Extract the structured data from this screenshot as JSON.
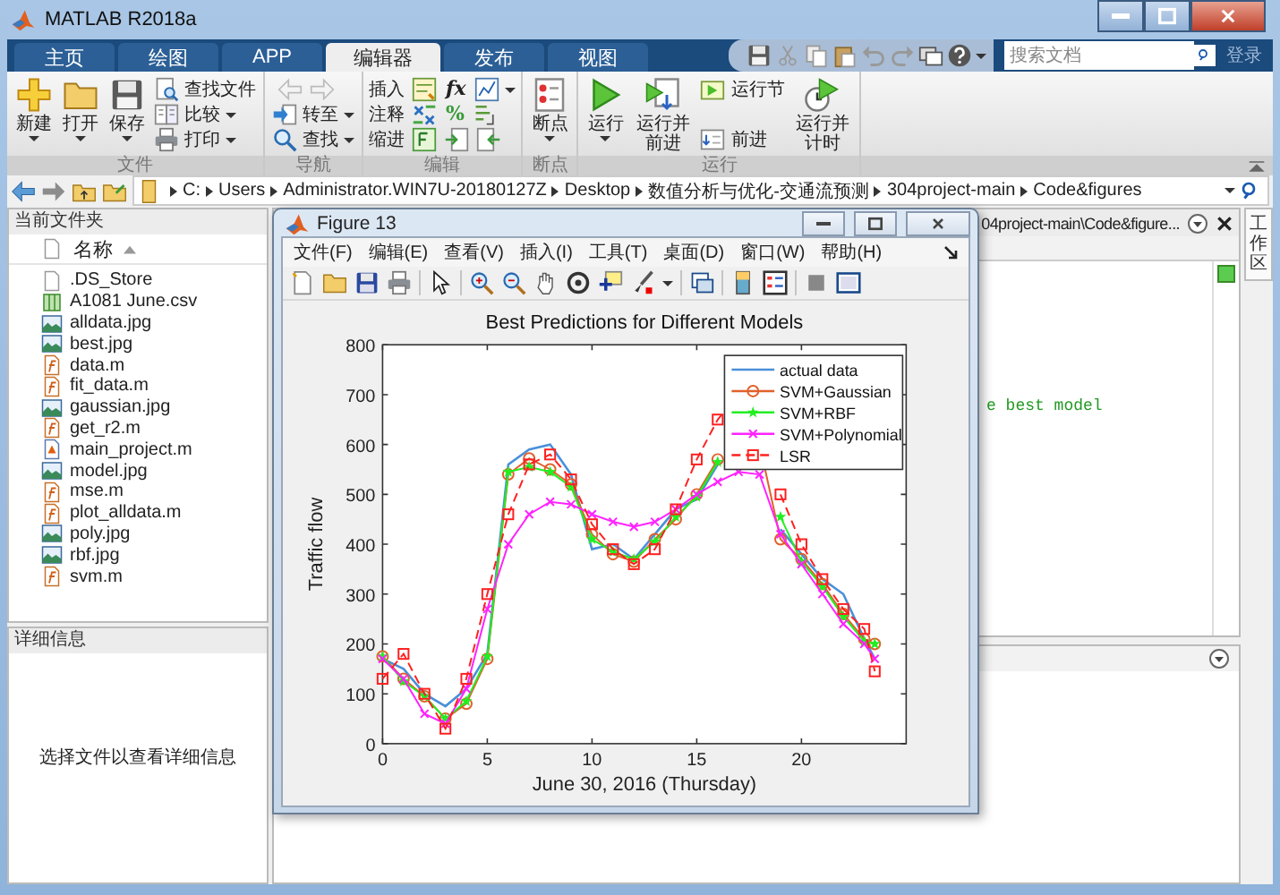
{
  "window": {
    "title": "MATLAB R2018a"
  },
  "tabs": [
    {
      "label": "主页",
      "selected": false
    },
    {
      "label": "绘图",
      "selected": false
    },
    {
      "label": "APP",
      "selected": false
    },
    {
      "label": "编辑器",
      "selected": true
    },
    {
      "label": "发布",
      "selected": false
    },
    {
      "label": "视图",
      "selected": false
    }
  ],
  "search": {
    "placeholder": "搜索文档"
  },
  "login": "登录",
  "ribbon": [
    {
      "label": "文件",
      "items": [
        {
          "kind": "large",
          "label": "新建",
          "dropdown": true
        },
        {
          "kind": "large",
          "label": "打开",
          "dropdown": true
        },
        {
          "kind": "large",
          "label": "保存",
          "dropdown": true
        },
        {
          "kind": "stack",
          "entries": [
            {
              "kind": "command",
              "label": "查找文件",
              "dropdown": false
            },
            {
              "kind": "command",
              "label": "比较",
              "dropdown": true
            },
            {
              "kind": "command",
              "label": "打印",
              "dropdown": true
            }
          ]
        }
      ]
    },
    {
      "label": "导航",
      "items": [
        {
          "kind": "stack",
          "entries": [
            {
              "kind": "arrows",
              "disabled": true
            },
            {
              "kind": "command",
              "label": "转至",
              "dropdown": true
            },
            {
              "kind": "command",
              "label": "查找",
              "dropdown": true
            }
          ]
        }
      ]
    },
    {
      "label": "编辑",
      "items": [
        {
          "kind": "edit",
          "rows": [
            {
              "label": "插入",
              "glyph": "fx",
              "dropdown": true
            },
            {
              "label": "注释",
              "glyph": "%",
              "dropdown": false
            },
            {
              "label": "缩进",
              "dropdown": false
            }
          ]
        }
      ]
    },
    {
      "label": "断点",
      "items": [
        {
          "kind": "large",
          "label": "断点",
          "dropdown": true
        }
      ]
    },
    {
      "label": "运行",
      "items": [
        {
          "kind": "large",
          "label": "运行",
          "dropdown": true
        },
        {
          "kind": "large",
          "label": "运行并前进",
          "dropdown": false
        },
        {
          "kind": "stack",
          "entries": [
            {
              "kind": "command",
              "label": "运行节",
              "dropdown": false
            },
            {
              "kind": "command",
              "label": "前进",
              "dropdown": false
            }
          ]
        },
        {
          "kind": "large",
          "label": "运行并计时",
          "dropdown": false
        }
      ]
    }
  ],
  "address": [
    "C:",
    "Users",
    "Administrator.WIN7U-20180127Z",
    "Desktop",
    "数值分析与优化-交通流预测",
    "304project-main",
    "Code&figures"
  ],
  "files": {
    "title": "当前文件夹",
    "column": "名称",
    "items": [
      {
        "name": ".DS_Store",
        "kind": "blank"
      },
      {
        "name": "A1081 June.csv",
        "kind": "csv"
      },
      {
        "name": "alldata.jpg",
        "kind": "image"
      },
      {
        "name": "best.jpg",
        "kind": "image"
      },
      {
        "name": "data.m",
        "kind": "function"
      },
      {
        "name": "fit_data.m",
        "kind": "function"
      },
      {
        "name": "gaussian.jpg",
        "kind": "image"
      },
      {
        "name": "get_r2.m",
        "kind": "function"
      },
      {
        "name": "main_project.m",
        "kind": "script"
      },
      {
        "name": "model.jpg",
        "kind": "image"
      },
      {
        "name": "mse.m",
        "kind": "function"
      },
      {
        "name": "plot_alldata.m",
        "kind": "function"
      },
      {
        "name": "poly.jpg",
        "kind": "image"
      },
      {
        "name": "rbf.jpg",
        "kind": "image"
      },
      {
        "name": "svm.m",
        "kind": "function"
      }
    ]
  },
  "details": {
    "title": "详细信息",
    "message": "选择文件以查看详细信息"
  },
  "editor": {
    "title": "04project-main\\Code&figure...",
    "code": [
      "e best model"
    ]
  },
  "side_tab": "工作区",
  "figure": {
    "title": "Figure 13",
    "menu": [
      "文件(F)",
      "编辑(E)",
      "查看(V)",
      "插入(I)",
      "工具(T)",
      "桌面(D)",
      "窗口(W)",
      "帮助(H)"
    ],
    "chart_data": {
      "type": "line",
      "title": "Best Predictions for Different Models",
      "xlabel": "June 30, 2016 (Thursday)",
      "ylabel": "Traffic flow",
      "x": [
        0,
        1,
        2,
        3,
        4,
        5,
        6,
        7,
        8,
        9,
        10,
        11,
        12,
        13,
        14,
        15,
        16,
        17,
        18,
        19,
        20,
        21,
        22,
        23,
        23.5
      ],
      "series": [
        {
          "name": "actual data",
          "color": "#4a90d9",
          "marker": "none",
          "line_style": "solid",
          "values": [
            170,
            150,
            100,
            75,
            110,
            180,
            560,
            590,
            600,
            540,
            390,
            400,
            370,
            420,
            470,
            490,
            560,
            null,
            null,
            430,
            380,
            330,
            300,
            210,
            170
          ]
        },
        {
          "name": "SVM+Gaussian",
          "color": "#e0602a",
          "marker": "circle",
          "line_style": "solid",
          "values": [
            175,
            130,
            95,
            50,
            80,
            170,
            540,
            572,
            550,
            520,
            420,
            380,
            365,
            410,
            450,
            500,
            570,
            null,
            600,
            410,
            370,
            320,
            260,
            210,
            200
          ]
        },
        {
          "name": "SVM+RBF",
          "color": "#22ee22",
          "marker": "star",
          "line_style": "solid",
          "values": [
            175,
            125,
            95,
            50,
            85,
            175,
            545,
            555,
            545,
            515,
            410,
            385,
            370,
            405,
            455,
            495,
            565,
            null,
            null,
            455,
            365,
            315,
            255,
            205,
            200
          ]
        },
        {
          "name": "SVM+Polynomial",
          "color": "#ff22ff",
          "marker": "cross",
          "line_style": "solid",
          "values": [
            170,
            130,
            60,
            40,
            110,
            270,
            400,
            460,
            485,
            480,
            460,
            445,
            435,
            445,
            470,
            500,
            525,
            545,
            540,
            420,
            360,
            300,
            240,
            200,
            170
          ]
        },
        {
          "name": "LSR",
          "color": "#ff2020",
          "marker": "square",
          "line_style": "dashed",
          "values": [
            130,
            180,
            100,
            30,
            130,
            300,
            460,
            560,
            580,
            530,
            440,
            390,
            360,
            390,
            470,
            570,
            650,
            700,
            null,
            500,
            400,
            330,
            270,
            230,
            145
          ]
        }
      ],
      "legend": true,
      "xlim": [
        0,
        25
      ],
      "ylim": [
        0,
        800
      ],
      "xticks": [
        0,
        5,
        10,
        15,
        20
      ],
      "yticks": [
        0,
        100,
        200,
        300,
        400,
        500,
        600,
        700,
        800
      ]
    }
  }
}
